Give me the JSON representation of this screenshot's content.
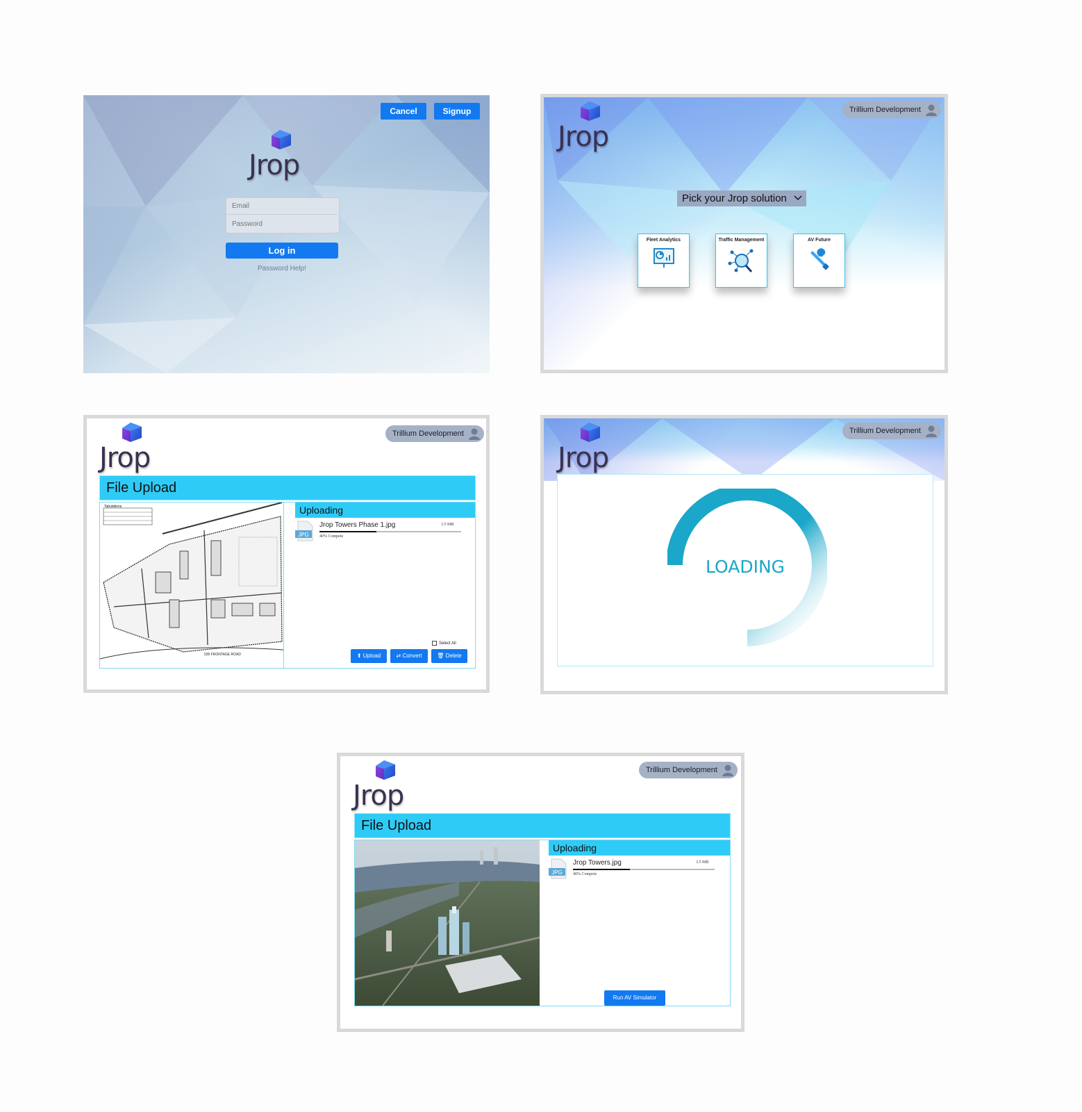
{
  "brand": {
    "name": "Jrop"
  },
  "login": {
    "cancel_label": "Cancel",
    "signup_label": "Signup",
    "email_placeholder": "Email",
    "password_placeholder": "Password",
    "login_label": "Log in",
    "password_help": "Password Help!"
  },
  "user": {
    "name": "Trillium Development"
  },
  "solutions": {
    "picker_label": "Pick your Jrop solution",
    "tiles": [
      {
        "label": "Fleet Analytics",
        "icon": "presentation-chart-icon"
      },
      {
        "label": "Traffic Management",
        "icon": "network-search-icon"
      },
      {
        "label": "AV Future",
        "icon": "tools-icon"
      }
    ]
  },
  "upload1": {
    "title": "File Upload",
    "uploading_label": "Uploading",
    "file_name": "Jrop Towers Phase 1.jpg",
    "file_size": "3.5 MB",
    "file_type": "JPG",
    "progress_text": "40% Compete",
    "progress": 0.4,
    "select_all_label": "Select All",
    "upload_label": "Upload",
    "convert_label": "Convert",
    "delete_label": "Delete",
    "plan_legend": "Tabulations",
    "plan_road": "535 FRONTAGE ROAD"
  },
  "loading": {
    "label": "LOADING"
  },
  "upload2": {
    "title": "File Upload",
    "uploading_label": "Uploading",
    "file_name": "Jrop Towers.jpg",
    "file_size": "3.5 MB",
    "file_type": "JPG",
    "progress_text": "40% Compete",
    "progress": 0.4,
    "run_label": "Run AV Simulator"
  },
  "colors": {
    "accent": "#1379f0",
    "cyan": "#2fcbf7",
    "loader": "#1aa7c9",
    "logo_text": "#3a3150"
  }
}
